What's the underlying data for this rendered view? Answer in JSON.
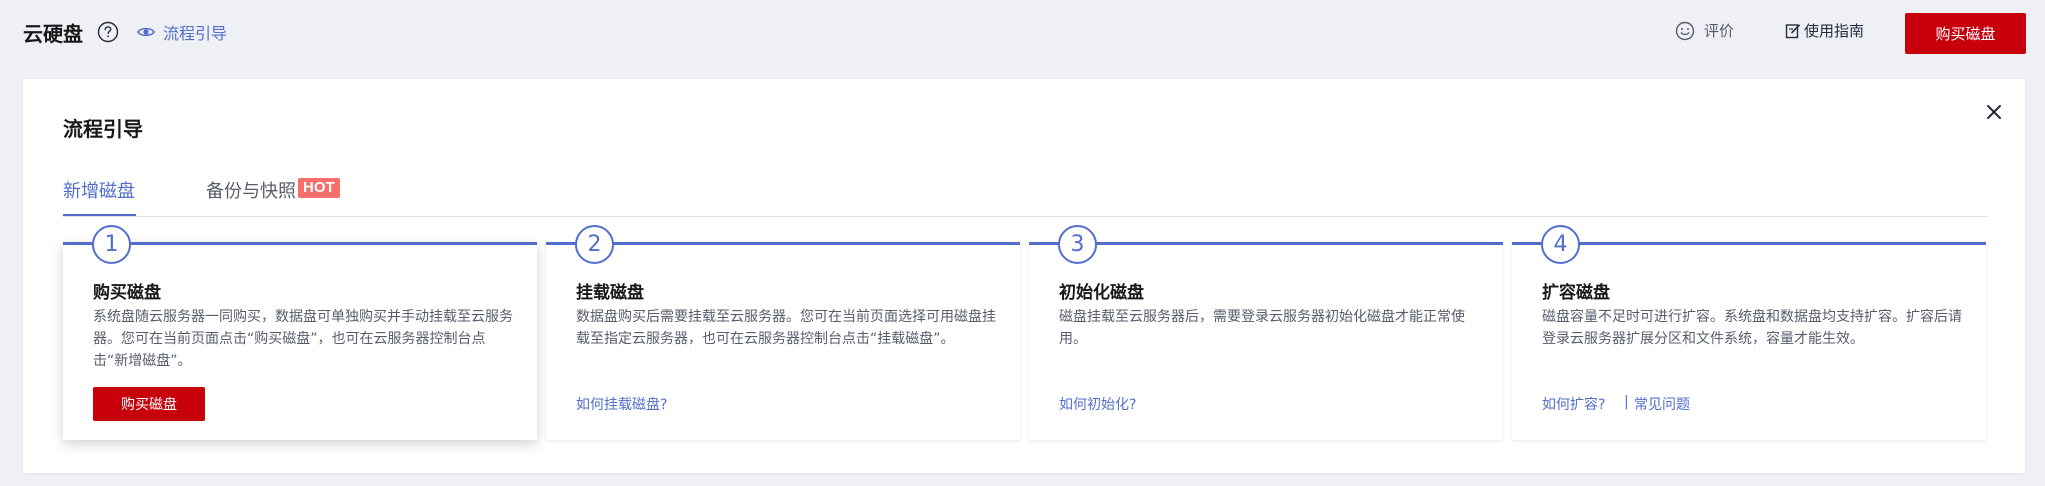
{
  "header": {
    "title": "云硬盘",
    "guide_label": "流程引导",
    "rate_label": "评价",
    "manual_label": "使用指南",
    "buy_label": "购买磁盘"
  },
  "panel": {
    "title": "流程引导",
    "tabs": [
      {
        "label": "新增磁盘",
        "active": true
      },
      {
        "label": "备份与快照",
        "badge": "HOT",
        "active": false
      }
    ],
    "steps": [
      {
        "num": "1",
        "title": "购买磁盘",
        "desc": "系统盘随云服务器一同购买，数据盘可单独购买并手动挂载至云服务器。您可在当前页面点击“购买磁盘”，也可在云服务器控制台点击“新增磁盘”。",
        "button": "购买磁盘"
      },
      {
        "num": "2",
        "title": "挂载磁盘",
        "desc": "数据盘购买后需要挂载至云服务器。您可在当前页面选择可用磁盘挂载至指定云服务器，也可在云服务器控制台点击“挂载磁盘”。",
        "link": "如何挂载磁盘?"
      },
      {
        "num": "3",
        "title": "初始化磁盘",
        "desc": "磁盘挂载至云服务器后，需要登录云服务器初始化磁盘才能正常使用。",
        "link": "如何初始化?"
      },
      {
        "num": "4",
        "title": "扩容磁盘",
        "desc": "磁盘容量不足时可进行扩容。系统盘和数据盘均支持扩容。扩容后请登录云服务器扩展分区和文件系统，容量才能生效。",
        "links": [
          "如何扩容?",
          "常见问题"
        ],
        "separator": "|"
      }
    ]
  },
  "colors": {
    "accent": "#526ecc",
    "brand_red": "#c7000b",
    "hot_badge": "#f66f6a",
    "background": "#eef0f5"
  },
  "icons": [
    "help-icon",
    "eye-icon",
    "smile-icon",
    "edit-icon",
    "close-icon"
  ]
}
